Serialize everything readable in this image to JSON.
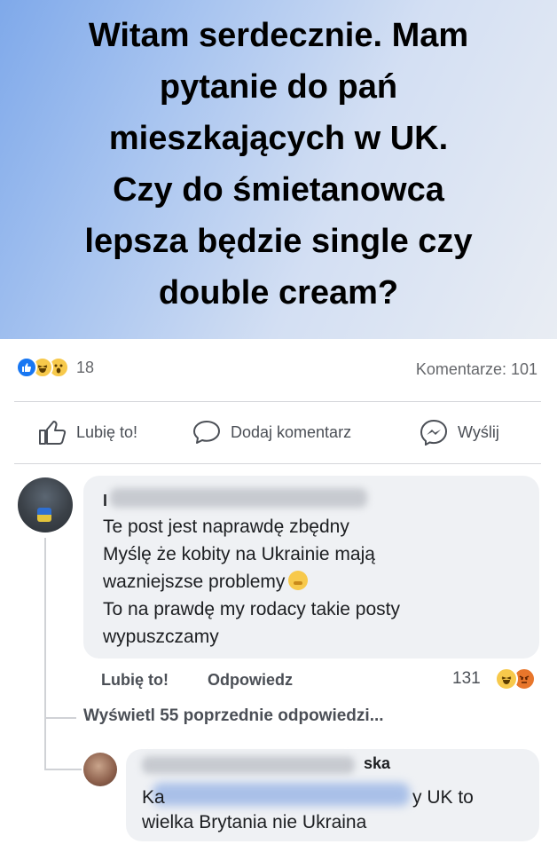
{
  "post": {
    "text": "Witam serdecznie. Mam\npytanie do pań\nmieszkających w UK.\nCzy do śmietanowca\nlepsza będzie single czy\ndouble cream?"
  },
  "stats": {
    "reactions_count": "18",
    "reaction_icons": [
      "like-icon",
      "haha-icon",
      "wow-icon"
    ],
    "comments_label": "Komentarze: 101"
  },
  "actions": {
    "like": "Lubię to!",
    "comment": "Dodaj komentarz",
    "send": "Wyślij"
  },
  "comments": [
    {
      "author_fragment": "I",
      "text": "Te post jest naprawdę zbędny\nMyślę że kobity na Ukrainie mają\nwazniejszse problemy",
      "text_tail": "To na prawdę my rodacy takie posty\nwypuszczamy",
      "like_label": "Lubię to!",
      "reply_label": "Odpowiedz",
      "reaction_count": "131",
      "reaction_icons": [
        "haha-icon",
        "angry-icon"
      ]
    }
  ],
  "view_previous": "Wyświetl 55 poprzednie odpowiedzi...",
  "reply": {
    "author_fragment": "ska",
    "line1_left": "Ka",
    "line1_right": "y UK to",
    "line2": "wielka Brytania nie Ukraina"
  },
  "colors": {
    "like_blue": "#1877f2",
    "bubble_bg": "#eff1f4",
    "muted_text": "#65676b"
  }
}
